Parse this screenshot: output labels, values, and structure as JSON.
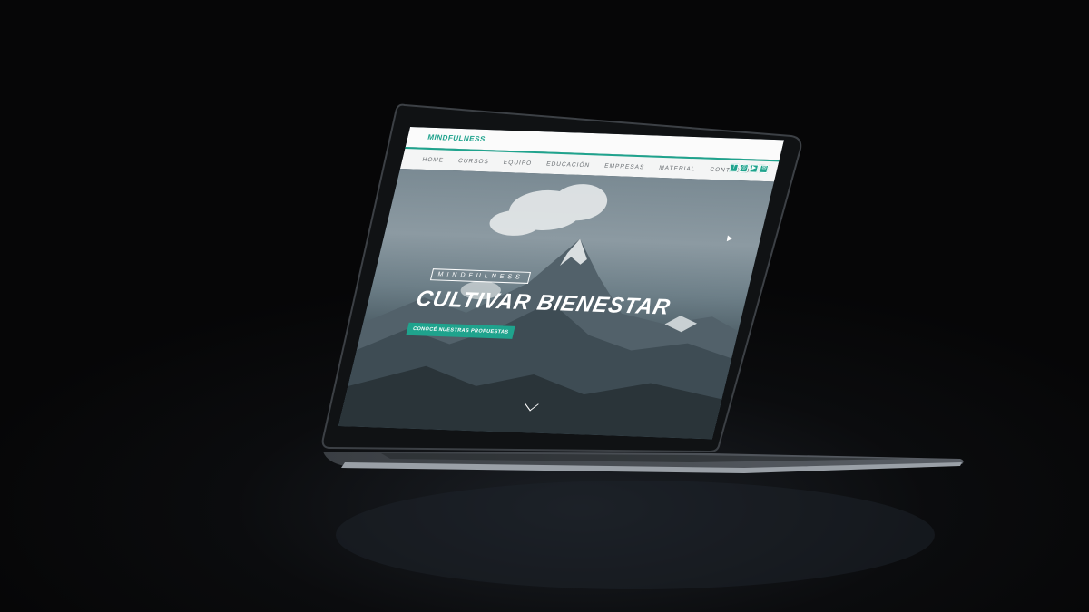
{
  "site": {
    "brand": "MINDFULNESS"
  },
  "nav": {
    "items": [
      "HOME",
      "CURSOS",
      "EQUIPO",
      "EDUCACIÓN",
      "EMPRESAS",
      "MATERIAL",
      "CONTACTO"
    ]
  },
  "social": {
    "icons": [
      "facebook-icon",
      "instagram-icon",
      "youtube-icon",
      "mail-icon"
    ]
  },
  "hero": {
    "kicker": "MINDFULNESS",
    "headline": "CULTIVAR BIENESTAR",
    "cta_label": "CONOCÉ NUESTRAS PROPUESTAS"
  },
  "colors": {
    "accent": "#1fa38d",
    "background": "#060607"
  }
}
